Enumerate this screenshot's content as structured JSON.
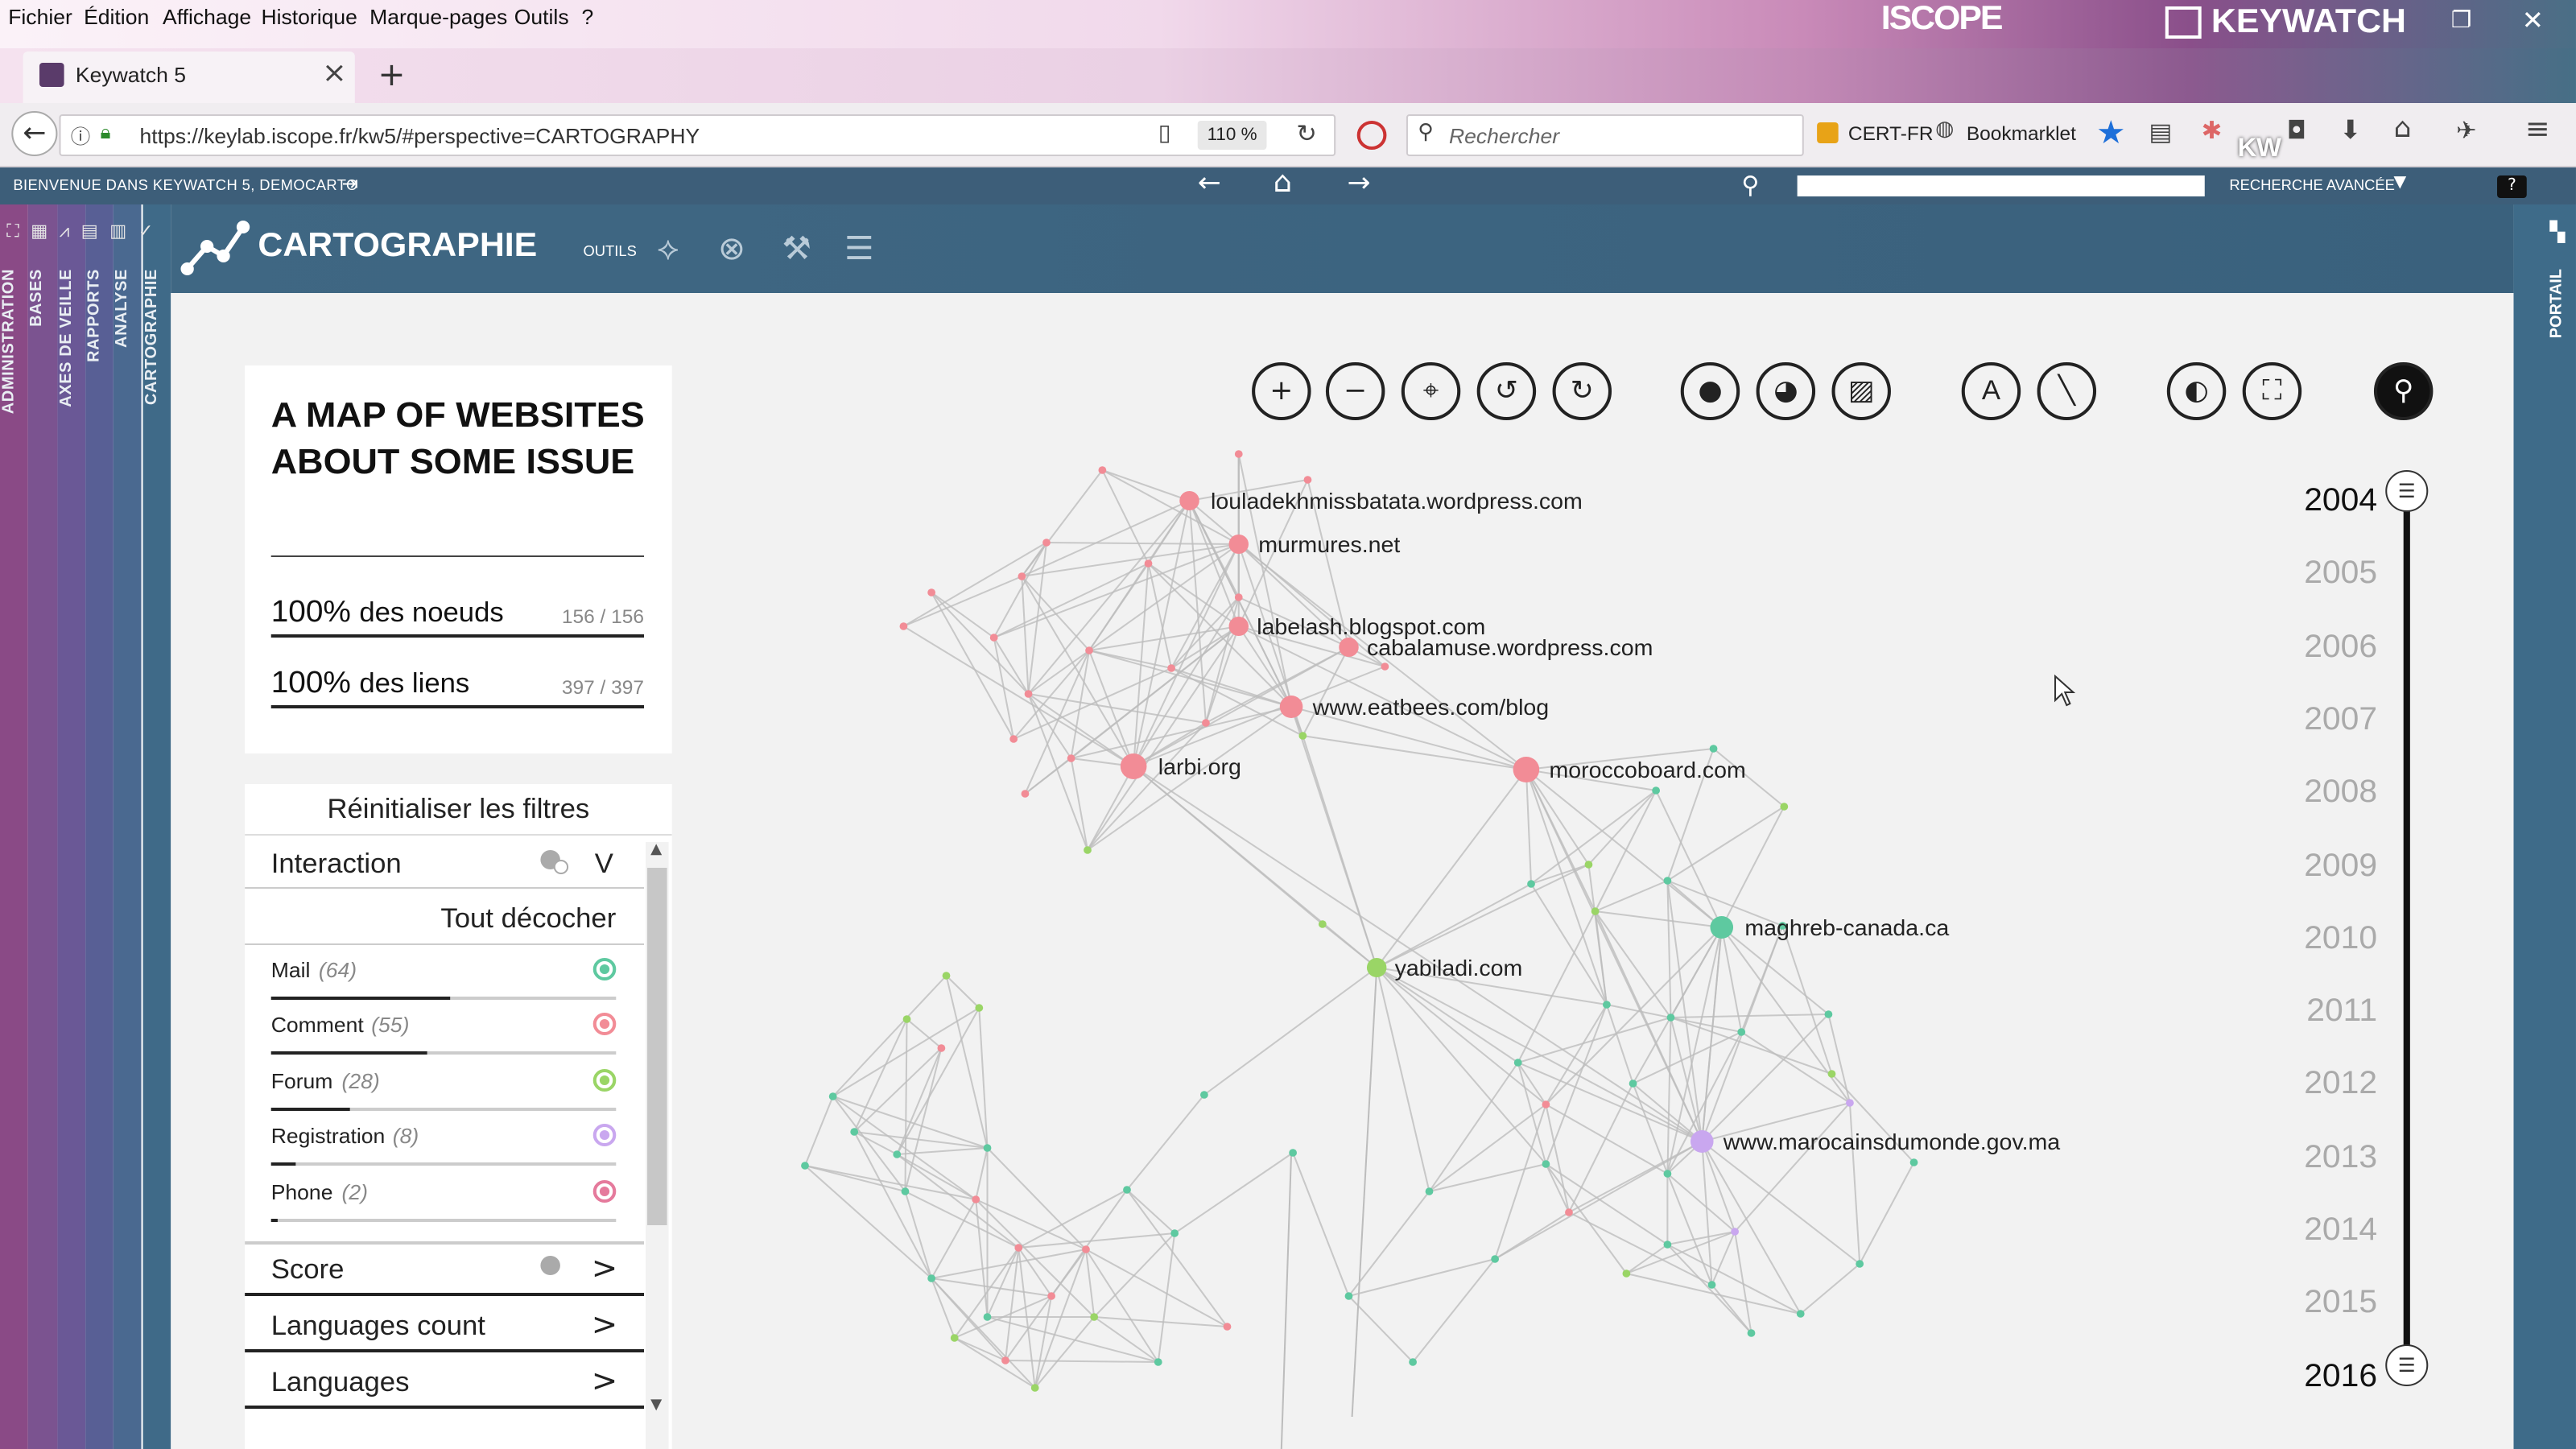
{
  "menu": [
    "Fichier",
    "Édition",
    "Affichage",
    "Historique",
    "Marque-pages",
    "Outils",
    "?"
  ],
  "tab": {
    "title": "Keywatch 5",
    "close": "×",
    "new": "+"
  },
  "brand": {
    "iscope": "ISCOPE",
    "keywatch": "KEYWATCH"
  },
  "url": {
    "address": "https://keylab.iscope.fr/kw5/#perspective=CARTOGRAPHY",
    "zoom": "110 %",
    "search_placeholder": "Rechercher",
    "bm1": "CERT-FR",
    "bm2": "Bookmarklet",
    "kw": "KW"
  },
  "appbar": {
    "welcome": "BIENVENUE DANS KEYWATCH 5, DEMOCARTO",
    "advanced": "RECHERCHE AVANCÉE",
    "help": "?"
  },
  "rails": [
    "ADMINISTRATION",
    "BASES",
    "AXES DE VEILLE",
    "RAPPORTS",
    "ANALYSE",
    "CARTOGRAPHIE"
  ],
  "right_rail": "PORTAIL",
  "header": {
    "title": "CARTOGRAPHIE",
    "outils": "OUTILS"
  },
  "map": {
    "title": "A MAP OF WEBSITES ABOUT SOME ISSUE",
    "nodes_pct": "100%",
    "nodes_label": "des noeuds",
    "nodes_count": "156 / 156",
    "links_pct": "100%",
    "links_label": "des liens",
    "links_count": "397 / 397"
  },
  "filters": {
    "reset": "Réinitialiser les filtres",
    "interaction": "Interaction",
    "interaction_arrow": "V",
    "uncheck_all": "Tout décocher",
    "items": [
      {
        "name": "Mail",
        "count": "(64)",
        "color": "#5ec9a0",
        "share": 0.52
      },
      {
        "name": "Comment",
        "count": "(55)",
        "color": "#f28c96",
        "share": 0.45
      },
      {
        "name": "Forum",
        "count": "(28)",
        "color": "#9ad566",
        "share": 0.23
      },
      {
        "name": "Registration",
        "count": "(8)",
        "color": "#c9a7ef",
        "share": 0.07
      },
      {
        "name": "Phone",
        "count": "(2)",
        "color": "#e57a9c",
        "share": 0.02
      }
    ],
    "score": "Score",
    "languages_count": "Languages count",
    "languages": "Languages",
    "chev": ">"
  },
  "graph_labels": [
    "louladekhmissbatata.wordpress.com",
    "murmures.net",
    "labelash.blogspot.com",
    "cabalamuse.wordpress.com",
    "www.eatbees.com/blog",
    "larbi.org",
    "moroccoboard.com",
    "maghreb-canada.ca",
    "yabiladi.com",
    "www.marocainsdumonde.gov.ma"
  ],
  "years": [
    "2004",
    "2005",
    "2006",
    "2007",
    "2008",
    "2009",
    "2010",
    "2011",
    "2012",
    "2013",
    "2014",
    "2015",
    "2016"
  ]
}
